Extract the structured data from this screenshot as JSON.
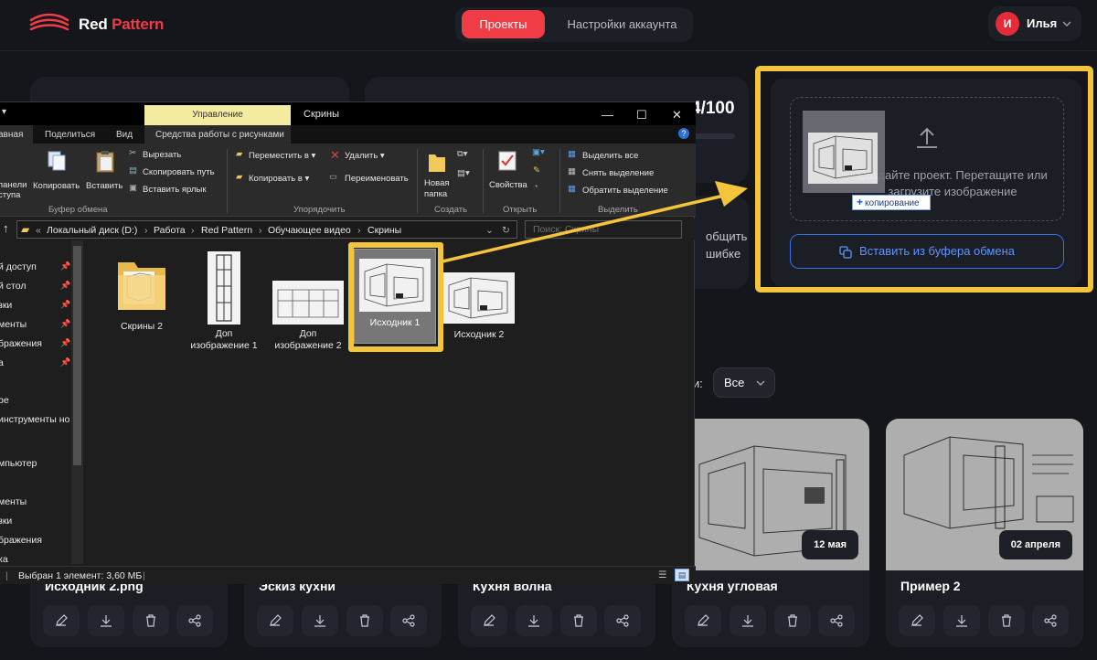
{
  "header": {
    "brand_first": "Red",
    "brand_second": "Pattern",
    "nav": [
      {
        "label": "Проекты",
        "active": true
      },
      {
        "label": "Настройки аккаунта",
        "active": false
      }
    ],
    "user": {
      "initial": "И",
      "name": "Илья"
    }
  },
  "stats": {
    "count": "4/100",
    "partial_line1": "общить",
    "partial_line2": "шибке"
  },
  "upload": {
    "drop_text": "Создайте проект. Перетащите или загрузите изображение",
    "paste_button": "Вставить из буфера обмена",
    "copy_badge": "копирование"
  },
  "filter": {
    "label": "и:",
    "value": "Все"
  },
  "projects": [
    {
      "title": "Исходник 2.png",
      "date": ""
    },
    {
      "title": "Эскиз кухни",
      "date": ""
    },
    {
      "title": "Кухня волна",
      "date": ""
    },
    {
      "title": "Кухня угловая",
      "date": "12 мая"
    },
    {
      "title": "Пример 2",
      "date": "02 апреля"
    }
  ],
  "explorer": {
    "context_tab": "Управление",
    "window_title": "Скрины",
    "tabs": [
      "авная",
      "Поделиться",
      "Вид",
      "Средства работы с рисунками"
    ],
    "ribbon": {
      "clipboard": {
        "pin": "панели\nступа",
        "copy": "Копировать",
        "paste": "Вставить",
        "cut": "Вырезать",
        "copy_path": "Скопировать путь",
        "paste_shortcut": "Вставить ярлык",
        "group": "Буфер обмена"
      },
      "organize": {
        "move": "Переместить в",
        "copy_to": "Копировать в",
        "delete": "Удалить",
        "rename": "Переименовать",
        "group": "Упорядочить"
      },
      "create": {
        "new_folder_1": "Новая",
        "new_folder_2": "папка",
        "group": "Создать"
      },
      "open": {
        "props": "Свойства",
        "group": "Открыть"
      },
      "select": {
        "all": "Выделить все",
        "none": "Снять выделение",
        "invert": "Обратить выделение",
        "group": "Выделить"
      }
    },
    "breadcrumb": [
      "Локальный диск (D:)",
      "Работа",
      "Red Pattern",
      "Обучающее видео",
      "Скрины"
    ],
    "search_placeholder": "Поиск: Скрины",
    "nav_items": [
      "й доступ",
      "й стол",
      "зки",
      "менты",
      "бражения",
      "а",
      "",
      "be",
      "инструменты но",
      "",
      "мпьютер",
      "",
      "менты",
      "зки",
      "бражения",
      "ка"
    ],
    "files": [
      {
        "name": "Скрины 2"
      },
      {
        "name": "Доп изображение 1"
      },
      {
        "name": "Доп изображение 2"
      },
      {
        "name": "Исходник 1"
      },
      {
        "name": "Исходник 2"
      }
    ],
    "status": "Выбран 1 элемент: 3,60 МБ"
  },
  "colors": {
    "accent": "#ef3c45",
    "highlight": "#f4c43d",
    "link": "#2f71ef",
    "bg": "#15161c",
    "card": "#1c1e26"
  }
}
